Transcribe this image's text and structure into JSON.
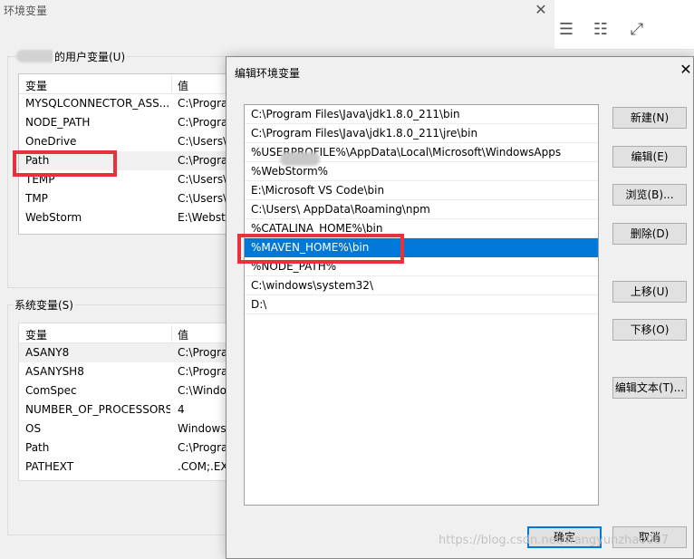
{
  "background_window": {
    "title": "环境变量",
    "close_glyph": "✕",
    "user_vars": {
      "label": "的用户变量(U)",
      "columns": [
        "变量",
        "值"
      ],
      "rows": [
        {
          "name": "MYSQLCONNECTOR_ASS...",
          "value": "C:\\Progra"
        },
        {
          "name": "NODE_PATH",
          "value": "C:\\Progra"
        },
        {
          "name": "OneDrive",
          "value": "C:\\Users\\"
        },
        {
          "name": "Path",
          "value": "C:\\Progra"
        },
        {
          "name": "TEMP",
          "value": "C:\\Users\\"
        },
        {
          "name": "TMP",
          "value": "C:\\Users\\"
        },
        {
          "name": "WebStorm",
          "value": "E:\\Webst"
        }
      ]
    },
    "system_vars": {
      "label": "系统变量(S)",
      "columns": [
        "变量",
        "值"
      ],
      "rows": [
        {
          "name": "ASANY8",
          "value": "C:\\Progra"
        },
        {
          "name": "ASANYSH8",
          "value": "C:\\Progra"
        },
        {
          "name": "ComSpec",
          "value": "C:\\Windo"
        },
        {
          "name": "NUMBER_OF_PROCESSORS",
          "value": "4"
        },
        {
          "name": "OS",
          "value": "Windows"
        },
        {
          "name": "Path",
          "value": "C:\\Progra"
        },
        {
          "name": "PATHEXT",
          "value": ".COM;.EX"
        }
      ]
    }
  },
  "toolbar": {
    "icons": [
      "☰",
      "☷",
      "⤢"
    ]
  },
  "dialog": {
    "title": "编辑环境变量",
    "close_glyph": "✕",
    "paths": [
      "C:\\Program Files\\Java\\jdk1.8.0_211\\bin",
      "C:\\Program Files\\Java\\jdk1.8.0_211\\jre\\bin",
      "%USERPROFILE%\\AppData\\Local\\Microsoft\\WindowsApps",
      "%WebStorm%",
      "E:\\Microsoft VS Code\\bin",
      "C:\\Users\\            AppData\\Roaming\\npm",
      "%CATALINA_HOME%\\bin",
      "%MAVEN_HOME%\\bin",
      "%NODE_PATH%",
      "C:\\windows\\system32\\",
      "D:\\"
    ],
    "selected_index": 7,
    "buttons": {
      "new": "新建(N)",
      "edit": "编辑(E)",
      "browse": "浏览(B)...",
      "delete": "删除(D)",
      "move_up": "上移(U)",
      "move_down": "下移(O)",
      "edit_text": "编辑文本(T)...",
      "ok": "确定",
      "cancel": "取消"
    }
  },
  "watermark": "https://blog.csdn.net/wangyunzhao007",
  "colors": {
    "highlight_red": "#e8313a",
    "selection_blue": "#0078d7"
  }
}
